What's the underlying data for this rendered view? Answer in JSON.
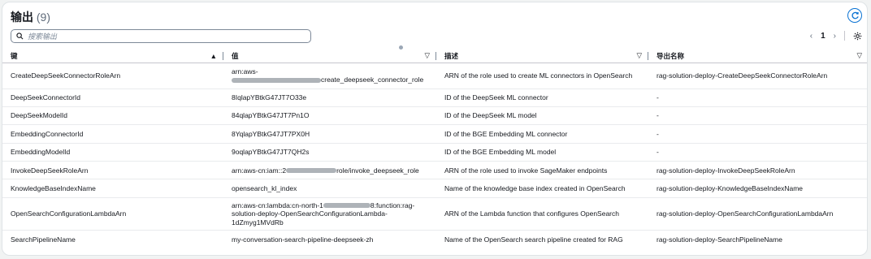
{
  "header": {
    "title": "输出",
    "count": "(9)"
  },
  "search": {
    "placeholder": "搜索输出"
  },
  "pagination": {
    "prev": "‹",
    "page": "1",
    "next": "›"
  },
  "columns": [
    {
      "label": "键",
      "sort": "▲"
    },
    {
      "label": "值",
      "sort": "▽"
    },
    {
      "label": "描述",
      "sort": "▽"
    },
    {
      "label": "导出名称",
      "sort": "▽"
    }
  ],
  "rows": [
    {
      "key": "CreateDeepSeekConnectorRoleArn",
      "value_line1": "arn:aws-",
      "value_line2": "create_deepseek_connector_role",
      "description": "ARN of the role used to create ML connectors in OpenSearch",
      "export": "rag-solution-deploy-CreateDeepSeekConnectorRoleArn"
    },
    {
      "key": "DeepSeekConnectorId",
      "value": "8IqlapYBtkG47JT7O33e",
      "description": "ID of the DeepSeek ML connector",
      "export": "-"
    },
    {
      "key": "DeepSeekModelId",
      "value": "84qlapYBtkG47JT7Pn1O",
      "description": "ID of the DeepSeek ML model",
      "export": "-"
    },
    {
      "key": "EmbeddingConnectorId",
      "value": "8YqlapYBtkG47JT7PX0H",
      "description": "ID of the BGE Embedding ML connector",
      "export": "-"
    },
    {
      "key": "EmbeddingModelId",
      "value": "9oqlapYBtkG47JT7QH2s",
      "description": "ID of the BGE Embedding ML model",
      "export": "-"
    },
    {
      "key": "InvokeDeepSeekRoleArn",
      "value_pre": "arn:aws-cn:iam::2",
      "value_post": "role/invoke_deepseek_role",
      "description": "ARN of the role used to invoke SageMaker endpoints",
      "export": "rag-solution-deploy-InvokeDeepSeekRoleArn"
    },
    {
      "key": "KnowledgeBaseIndexName",
      "value": "opensearch_kl_index",
      "description": "Name of the knowledge base index created in OpenSearch",
      "export": "rag-solution-deploy-KnowledgeBaseIndexName"
    },
    {
      "key": "OpenSearchConfigurationLambdaArn",
      "value_pre": "arn:aws-cn:lambda:cn-north-1",
      "value_post": "8:function:rag-",
      "value_line2": "solution-deploy-OpenSearchConfigurationLambda-",
      "value_line3": "1dZmyg1MVdRb",
      "description": "ARN of the Lambda function that configures OpenSearch",
      "export": "rag-solution-deploy-OpenSearchConfigurationLambdaArn"
    },
    {
      "key": "SearchPipelineName",
      "value": "my-conversation-search-pipeline-deepseek-zh",
      "description": "Name of the OpenSearch search pipeline created for RAG",
      "export": "rag-solution-deploy-SearchPipelineName"
    }
  ],
  "colors": {
    "accent": "#0972d3",
    "border": "#c6c6cd",
    "text": "#16191f"
  }
}
